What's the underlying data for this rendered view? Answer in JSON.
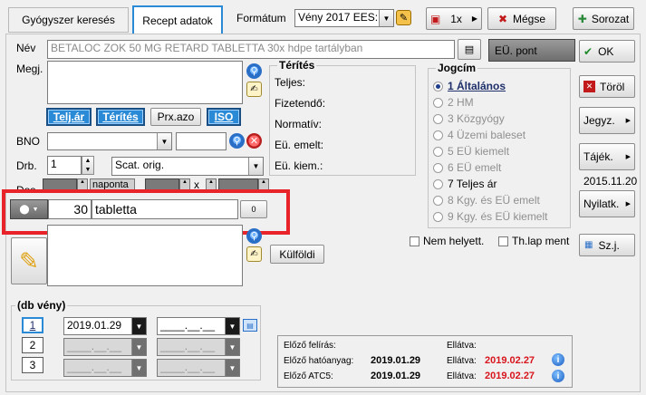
{
  "tabs": [
    {
      "label": "Gyógyszer keresés",
      "active": false
    },
    {
      "label": "Recept adatok",
      "active": true
    }
  ],
  "toolbar": {
    "format_label": "Formátum",
    "format_value": "Vény 2017 EES:",
    "copies_label": "1x",
    "cancel_label": "Mégse",
    "queue_label": "Sorozat"
  },
  "drug": {
    "name_label": "Név",
    "name_value": "BETALOC ZOK 50 MG RETARD TABLETTA 30x hdpe tartályban",
    "eu_point_label": "EÜ. pont",
    "note_label": "Megj.",
    "bno_label": "BNO",
    "qty_label": "Drb.",
    "qty_value": "1",
    "pack_type_value": "Scat. orig.",
    "dos_label": "Dos",
    "dos_daily": "naponta",
    "dos_x": "x",
    "amount_value": "30",
    "unit_value": "tabletta",
    "unit_extra": "0"
  },
  "price_buttons": {
    "telj_ar": "Telj.ár",
    "terites": "Térítés",
    "prx_azo": "Prx.azo",
    "iso": "ISO"
  },
  "payment": {
    "title": "Térítés",
    "rows": [
      "Teljes:",
      "Fizetendő:",
      "Normatív:",
      "Eü. emelt:",
      "Eü. kiem.:"
    ]
  },
  "entitlement": {
    "title": "Jogcím",
    "items": [
      {
        "label": "1 Általános",
        "selected": true,
        "enabled": true
      },
      {
        "label": "2 HM",
        "selected": false,
        "enabled": false
      },
      {
        "label": "3 Közgyógy",
        "selected": false,
        "enabled": false
      },
      {
        "label": "4 Üzemi baleset",
        "selected": false,
        "enabled": false
      },
      {
        "label": "5 EÜ kiemelt",
        "selected": false,
        "enabled": false
      },
      {
        "label": "6 EÜ emelt",
        "selected": false,
        "enabled": false
      },
      {
        "label": "7 Teljes ár",
        "selected": false,
        "enabled": true
      },
      {
        "label": "8 Kgy. és EÜ emelt",
        "selected": false,
        "enabled": false
      },
      {
        "label": "9 Kgy. és EÜ kiemelt",
        "selected": false,
        "enabled": false
      }
    ]
  },
  "checks": {
    "not_substitute": "Nem helyett.",
    "th_lap": "Th.lap ment"
  },
  "side_buttons": {
    "ok": "OK",
    "delete": "Töröl",
    "jegyz": "Jegyz.",
    "tajek": "Tájék.",
    "date": "2015.11.20",
    "nyilatk": "Nyilatk.",
    "szj": "Sz.j."
  },
  "foreign_label": "Külföldi",
  "db_veny": {
    "title": "(db vény)",
    "rows": [
      {
        "num": "1",
        "date": "2019.01.29",
        "date2": "____.__.__"
      },
      {
        "num": "2",
        "date": "____.__.__",
        "date2": "____.__.__"
      },
      {
        "num": "3",
        "date": "____.__.__",
        "date2": "____.__.__"
      }
    ]
  },
  "history": {
    "prev_rx_label": "Előző felírás:",
    "prev_rx_ellatva": "Ellátva:",
    "prev_active_label": "Előző hatóanyag:",
    "prev_active_date": "2019.01.29",
    "prev_active_ellatva": "Ellátva:",
    "prev_active_ellatva_date": "2019.02.27",
    "prev_atc_label": "Előző ATC5:",
    "prev_atc_date": "2019.01.29",
    "prev_atc_ellatva": "Ellátva:",
    "prev_atc_ellatva_date": "2019.02.27"
  },
  "colors": {
    "accent_blue": "#2a8ad6",
    "highlight_red": "#e8232a",
    "date_red": "#d8141c"
  }
}
